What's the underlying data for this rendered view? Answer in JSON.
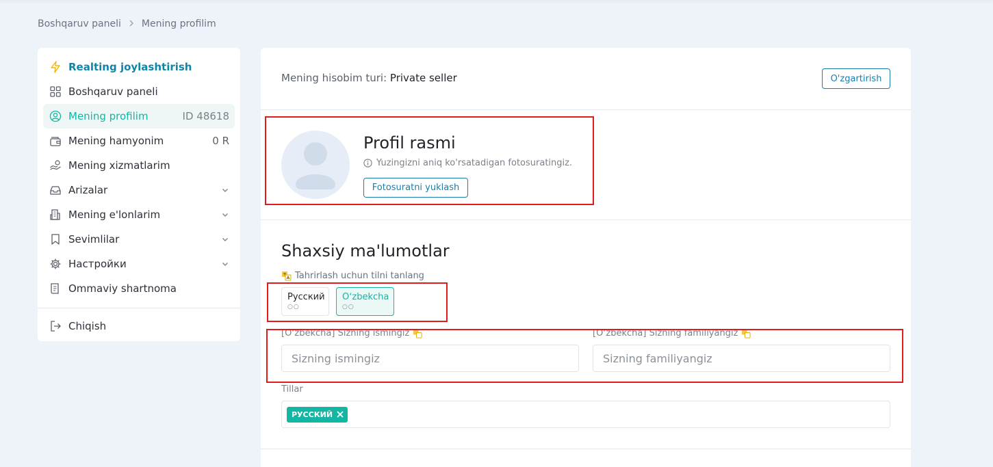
{
  "breadcrumb": {
    "items": [
      "Boshqaruv paneli",
      "Mening profilim"
    ]
  },
  "sidebar": {
    "items": [
      {
        "label": "Realting joylashtirish",
        "icon": "lightning-icon"
      },
      {
        "label": "Boshqaruv paneli",
        "icon": "grid-icon"
      },
      {
        "label": "Mening profilim",
        "icon": "user-circle-icon",
        "extra": "ID 48618"
      },
      {
        "label": "Mening hamyonim",
        "icon": "wallet-icon",
        "extra": "0 R"
      },
      {
        "label": "Mening xizmatlarim",
        "icon": "hand-coins-icon"
      },
      {
        "label": "Arizalar",
        "icon": "inbox-icon"
      },
      {
        "label": "Mening e'lonlarim",
        "icon": "building-icon"
      },
      {
        "label": "Sevimlilar",
        "icon": "bookmark-icon"
      },
      {
        "label": "Настройки",
        "icon": "gear-icon"
      },
      {
        "label": "Ommaviy shartnoma",
        "icon": "document-icon"
      }
    ],
    "logout": {
      "label": "Chiqish",
      "icon": "logout-icon"
    }
  },
  "account": {
    "prefix": "Mening hisobim turi: ",
    "type": "Private seller",
    "change_button": "O'zgartirish"
  },
  "profile_photo": {
    "title": "Profil rasmi",
    "hint": "Yuzingizni aniq ko'rsatadigan fotosuratingiz.",
    "upload_button": "Fotosuratni yuklash"
  },
  "personal": {
    "title": "Shaxsiy ma'lumotlar",
    "lang_hint": "Tahrirlash uchun tilni tanlang",
    "languages": [
      {
        "label": "Русский",
        "dots": "○○"
      },
      {
        "label": "Oʻzbekcha",
        "dots": "○○"
      }
    ],
    "first_name": {
      "label": "[Oʻzbekcha] Sizning ismingiz",
      "placeholder": "Sizning ismingiz",
      "value": ""
    },
    "last_name": {
      "label": "[Oʻzbekcha] Sizning familiyangiz",
      "placeholder": "Sizning familiyangiz",
      "value": ""
    },
    "tillar_label": "Tillar",
    "tags": [
      "РУССКИЙ"
    ]
  },
  "colors": {
    "accent_teal": "#13b5a3",
    "link_blue": "#1a7fa8",
    "highlight_red": "#e01b1b",
    "page_bg": "#eef2f9"
  }
}
